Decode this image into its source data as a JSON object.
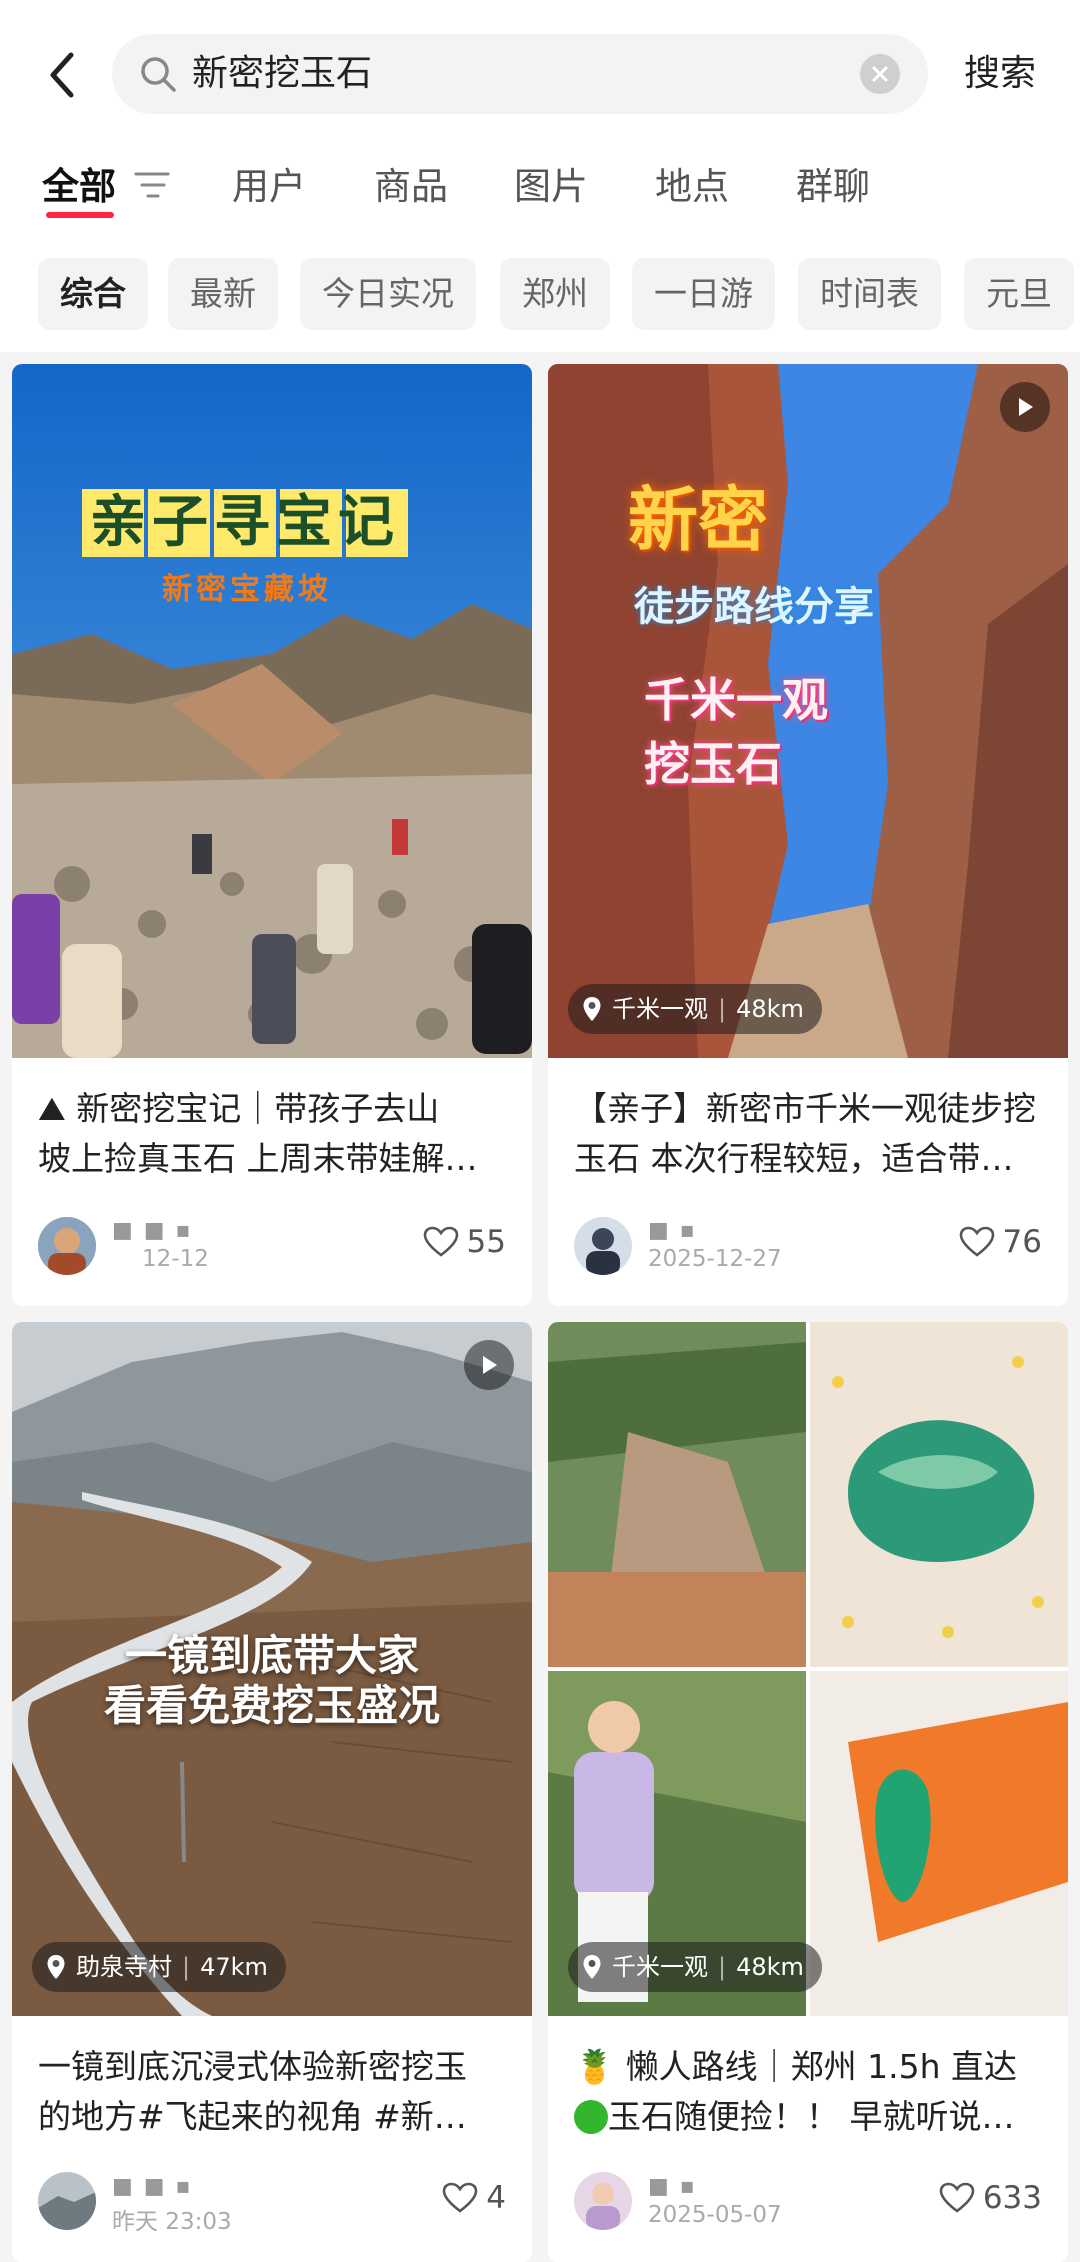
{
  "search": {
    "query": "新密挖玉石",
    "submit_label": "搜索"
  },
  "tabs": [
    "全部",
    "用户",
    "商品",
    "图片",
    "地点",
    "群聊"
  ],
  "chips": [
    "综合",
    "最新",
    "今日实况",
    "郑州",
    "一日游",
    "时间表",
    "元旦"
  ],
  "cards": [
    {
      "cover_title": "亲子寻宝记",
      "cover_subtitle": "新密宝藏坡",
      "title_line1": "新密挖宝记｜带孩子去山",
      "title_line2": "坡上捡真玉石 上周末带娃解…",
      "author": "■ ■ ▪",
      "date": "12-12",
      "likes": "55"
    },
    {
      "cover_title": "新密",
      "cover_subtitle": "徒步路线分享",
      "cover_line3": "千米一观",
      "cover_line4": "挖玉石",
      "location": "千米一观",
      "distance": "48km",
      "title_line1": "【亲子】新密市千米一观徒步挖",
      "title_line2": "玉石 本次行程较短，适合带…",
      "author": "■ ▪",
      "date": "2025-12-27",
      "likes": "76"
    },
    {
      "cover_line1": "一镜到底带大家",
      "cover_line2": "看看免费挖玉盛况",
      "location": "助泉寺村",
      "distance": "47km",
      "title_line1": "一镜到底沉浸式体验新密挖玉",
      "title_line2": "的地方#飞起来的视角 #新…",
      "author": "■ ■ ▪",
      "date": "昨天 23:03",
      "likes": "4"
    },
    {
      "location": "千米一观",
      "distance": "48km",
      "title_line1": "懒人路线｜郑州 1.5h 直达",
      "title_line2": "玉石随便捡！！ 早就听说…",
      "author": "■ ▪",
      "date": "2025-05-07",
      "likes": "633"
    }
  ]
}
